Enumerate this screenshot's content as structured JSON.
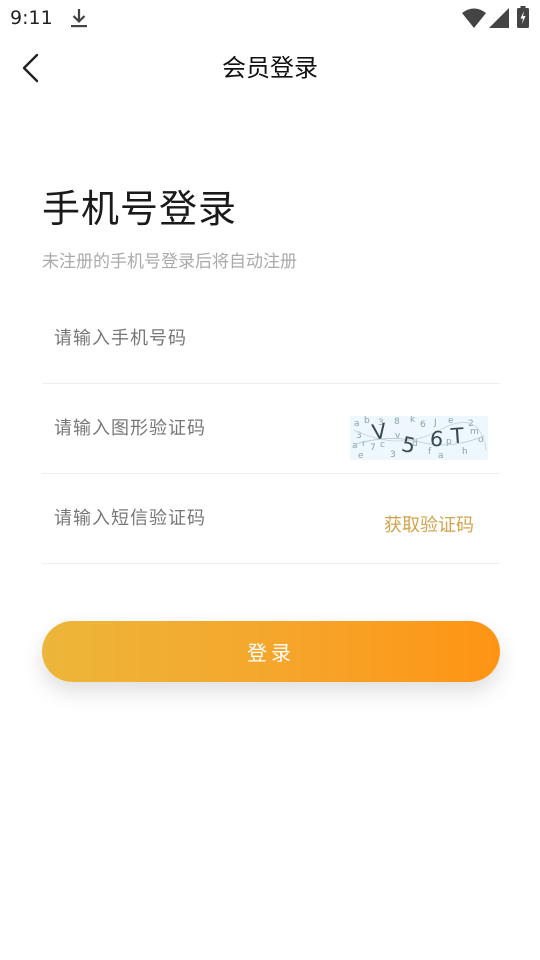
{
  "status_bar": {
    "time": "9:11",
    "icons": [
      "download-icon",
      "wifi-icon",
      "signal-icon",
      "battery-icon"
    ]
  },
  "nav": {
    "title": "会员登录",
    "back_icon": "chevron-left-icon"
  },
  "login": {
    "heading": "手机号登录",
    "subheading": "未注册的手机号登录后将自动注册"
  },
  "form": {
    "phone_placeholder": "请输入手机号码",
    "captcha_placeholder": "请输入图形验证码",
    "captcha_text": "V56T",
    "sms_placeholder": "请输入短信验证码",
    "sms_button_label": "获取验证码",
    "submit_label": "登录"
  },
  "colors": {
    "accent_gold": "#d4a24a",
    "button_gradient_start": "#ecb63a",
    "button_gradient_end": "#fe9414",
    "placeholder": "#777777",
    "hint": "#aaaaaa"
  }
}
